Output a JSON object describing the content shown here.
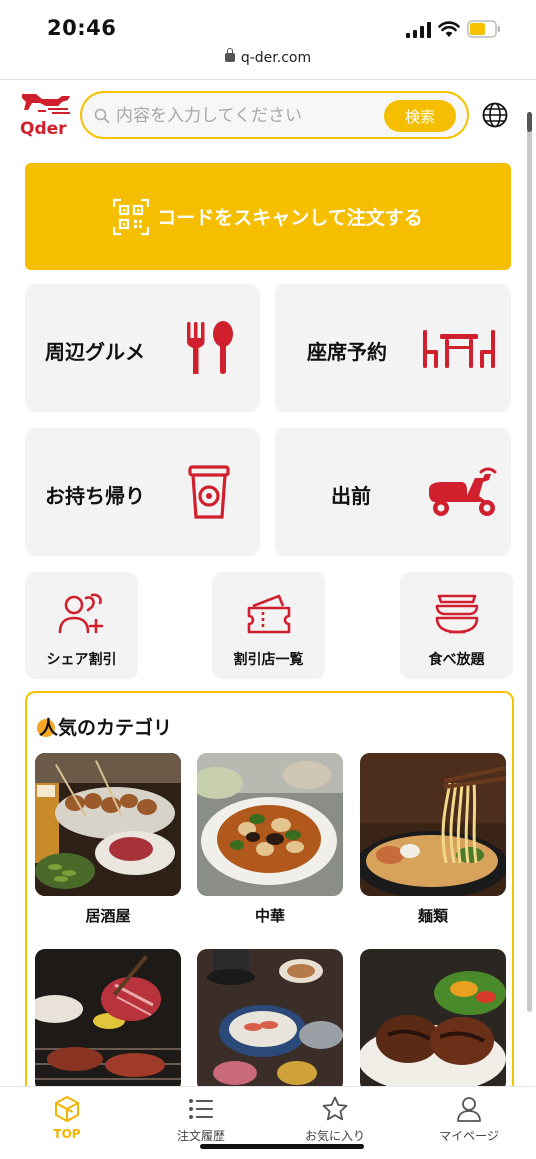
{
  "status_bar": {
    "time": "20:46",
    "url": "q-der.com"
  },
  "header": {
    "logo_text": "Qder",
    "search_placeholder": "内容を入力してください",
    "search_button": "検索"
  },
  "scan_banner": {
    "label": "コードをスキャンして注文する",
    "icon": "qr-code-icon"
  },
  "services": [
    {
      "label": "周辺グルメ",
      "icon": "fork-spoon-icon"
    },
    {
      "label": "座席予約",
      "icon": "table-chairs-icon"
    },
    {
      "label": "お持ち帰り",
      "icon": "takeaway-cup-icon"
    },
    {
      "label": "出前",
      "icon": "scooter-icon"
    }
  ],
  "quick_links": [
    {
      "label": "シェア割引",
      "icon": "group-plus-icon"
    },
    {
      "label": "割引店一覧",
      "icon": "coupon-icon"
    },
    {
      "label": "食べ放題",
      "icon": "bowls-icon"
    }
  ],
  "popular": {
    "title": "人気のカテゴリ",
    "categories": [
      {
        "label": "居酒屋"
      },
      {
        "label": "中華"
      },
      {
        "label": "麺類"
      },
      {
        "label": ""
      },
      {
        "label": ""
      },
      {
        "label": ""
      }
    ]
  },
  "bottom_nav": [
    {
      "label": "TOP",
      "icon": "top-cube-icon",
      "active": true
    },
    {
      "label": "注文履歴",
      "icon": "list-icon",
      "active": false
    },
    {
      "label": "お気に入り",
      "icon": "star-icon",
      "active": false
    },
    {
      "label": "マイページ",
      "icon": "person-icon",
      "active": false
    }
  ],
  "colors": {
    "accent": "#f5bf00",
    "brand_red": "#d0202e"
  }
}
